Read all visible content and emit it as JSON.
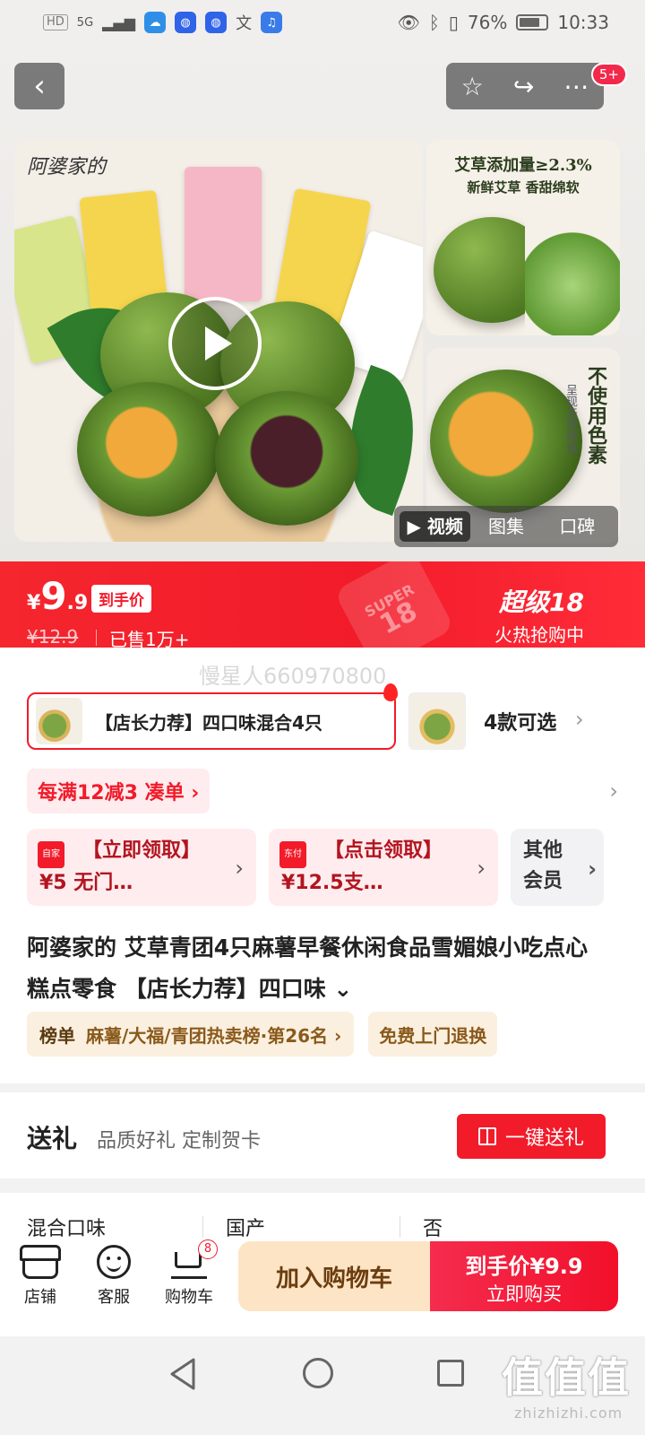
{
  "status_bar": {
    "hd": "HD",
    "network": "5G",
    "battery": "76%",
    "time": "10:33"
  },
  "media": {
    "brand": "阿婆家的",
    "side1_title": "艾草添加量≥2.3%",
    "side1_sub": "新鲜艾草 香甜绵软",
    "side2_title": "不使用色素",
    "side2_sub": "呈现天然绿色",
    "tabs": [
      "视频",
      "图集",
      "口碑"
    ],
    "more_badge": "5+"
  },
  "price": {
    "currency": "¥",
    "integer": "9",
    "decimal": ".9",
    "tag": "到手价",
    "original": "¥12.9",
    "sold": "已售1万+",
    "stamp_top": "SUPER",
    "stamp_num": "18",
    "super_title": "超级18",
    "super_sub": "火热抢购中"
  },
  "watermark": "慢星人660970800",
  "sku": {
    "selected": "【店长力荐】四口味混合4只",
    "more": "4款可选"
  },
  "promo": {
    "text": "每满12减3 凑单 ›"
  },
  "coupons": [
    {
      "icon": "自家",
      "text": "【立即领取】¥5 无门…"
    },
    {
      "icon": "东付",
      "text": "【点击领取】¥12.5支…"
    }
  ],
  "member": "其他会员",
  "product_title": "阿婆家的 艾草青团4只麻薯早餐休闲食品雪媚娘小吃点心糕点零食 【店长力荐】四口味 ⌄",
  "rank": {
    "label": "榜单",
    "text": "麻薯/大福/青团热卖榜·第26名 ›"
  },
  "free_return": "免费上门退换",
  "gift": {
    "title": "送礼",
    "sub": "品质好礼 定制贺卡",
    "button": "一键送礼"
  },
  "specs": [
    "混合口味",
    "国产",
    "否"
  ],
  "action_bar": {
    "store": "店铺",
    "service": "客服",
    "cart": "购物车",
    "cart_count": "8",
    "add_cart": "加入购物车",
    "buy_top": "到手价¥9.9",
    "buy_bottom": "立即购买"
  },
  "footer": {
    "logo": "值值值",
    "url": "zhizhizhi.com"
  },
  "colors": {
    "accent": "#f21b2a",
    "gold_bg": "#fbf0df",
    "cart_bg": "#fde4c4"
  }
}
